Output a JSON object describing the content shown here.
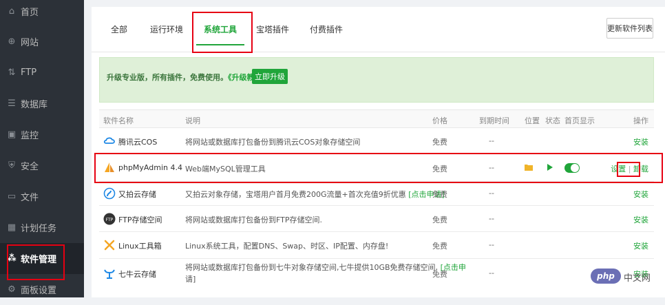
{
  "sidebar": {
    "items": [
      {
        "label": "首页",
        "icon": "home-icon",
        "glyph": "⌂"
      },
      {
        "label": "网站",
        "icon": "globe-icon",
        "glyph": "⊕"
      },
      {
        "label": "FTP",
        "icon": "ftp-icon",
        "glyph": "⇅"
      },
      {
        "label": "数据库",
        "icon": "database-icon",
        "glyph": "☰"
      },
      {
        "label": "监控",
        "icon": "monitor-icon",
        "glyph": "▣"
      },
      {
        "label": "安全",
        "icon": "shield-icon",
        "glyph": "⛨"
      },
      {
        "label": "文件",
        "icon": "folder-icon",
        "glyph": "▭"
      },
      {
        "label": "计划任务",
        "icon": "calendar-icon",
        "glyph": "▦"
      },
      {
        "label": "软件管理",
        "icon": "apps-icon",
        "glyph": "⁂"
      },
      {
        "label": "面板设置",
        "icon": "gear-icon",
        "glyph": "⚙"
      }
    ],
    "active_index": 8
  },
  "tabs": {
    "items": [
      "全部",
      "运行环境",
      "系统工具",
      "宝塔插件",
      "付费插件"
    ],
    "active_index": 2,
    "refresh_label": "更新软件列表"
  },
  "promo": {
    "text": "升级专业版，所有插件，免费使用。",
    "link": "《升级教程》",
    "button": "立即升级"
  },
  "table": {
    "headers": {
      "name": "软件名称",
      "desc": "说明",
      "price": "价格",
      "expire": "到期时间",
      "location": "位置",
      "status": "状态",
      "home": "首页显示",
      "op": "操作"
    },
    "rows": [
      {
        "name": "腾讯云COS",
        "desc": "将网站或数据库打包备份到腾讯云COS对象存储空间",
        "price": "免费",
        "expire": "--",
        "op": "安装"
      },
      {
        "name": "phpMyAdmin 4.4",
        "desc": "Web端MySQL管理工具",
        "price": "免费",
        "expire": "--",
        "op_setting": "设置",
        "op_sep": " | ",
        "op_uninstall": "卸载",
        "home_enabled": true
      },
      {
        "name": "又拍云存储",
        "desc": "又拍云对象存储，宝塔用户首月免费200G流量+首次充值9折优惠",
        "desc_link": "[点击申请]",
        "price": "免费",
        "expire": "--",
        "op": "安装"
      },
      {
        "name": "FTP存储空间",
        "desc": "将网站或数据库打包备份到FTP存储空间.",
        "price": "免费",
        "expire": "--",
        "op": "安装"
      },
      {
        "name": "Linux工具箱",
        "desc": "Linux系统工具，配置DNS、Swap、时区、IP配置、内存盘!",
        "price": "免费",
        "expire": "--",
        "op": "安装"
      },
      {
        "name": "七牛云存储",
        "desc": "将网站或数据库打包备份到七牛对象存储空间,七牛提供10GB免费存储空间,",
        "desc_link": "[点击申",
        "desc_line2": "请]",
        "price": "免费",
        "expire": "--",
        "op": "安装"
      }
    ]
  },
  "watermark": {
    "text": "php",
    "site": "中文网"
  },
  "colors": {
    "accent": "#20a53a",
    "sidebar_bg": "#2c3138",
    "highlight": "#e60012"
  }
}
